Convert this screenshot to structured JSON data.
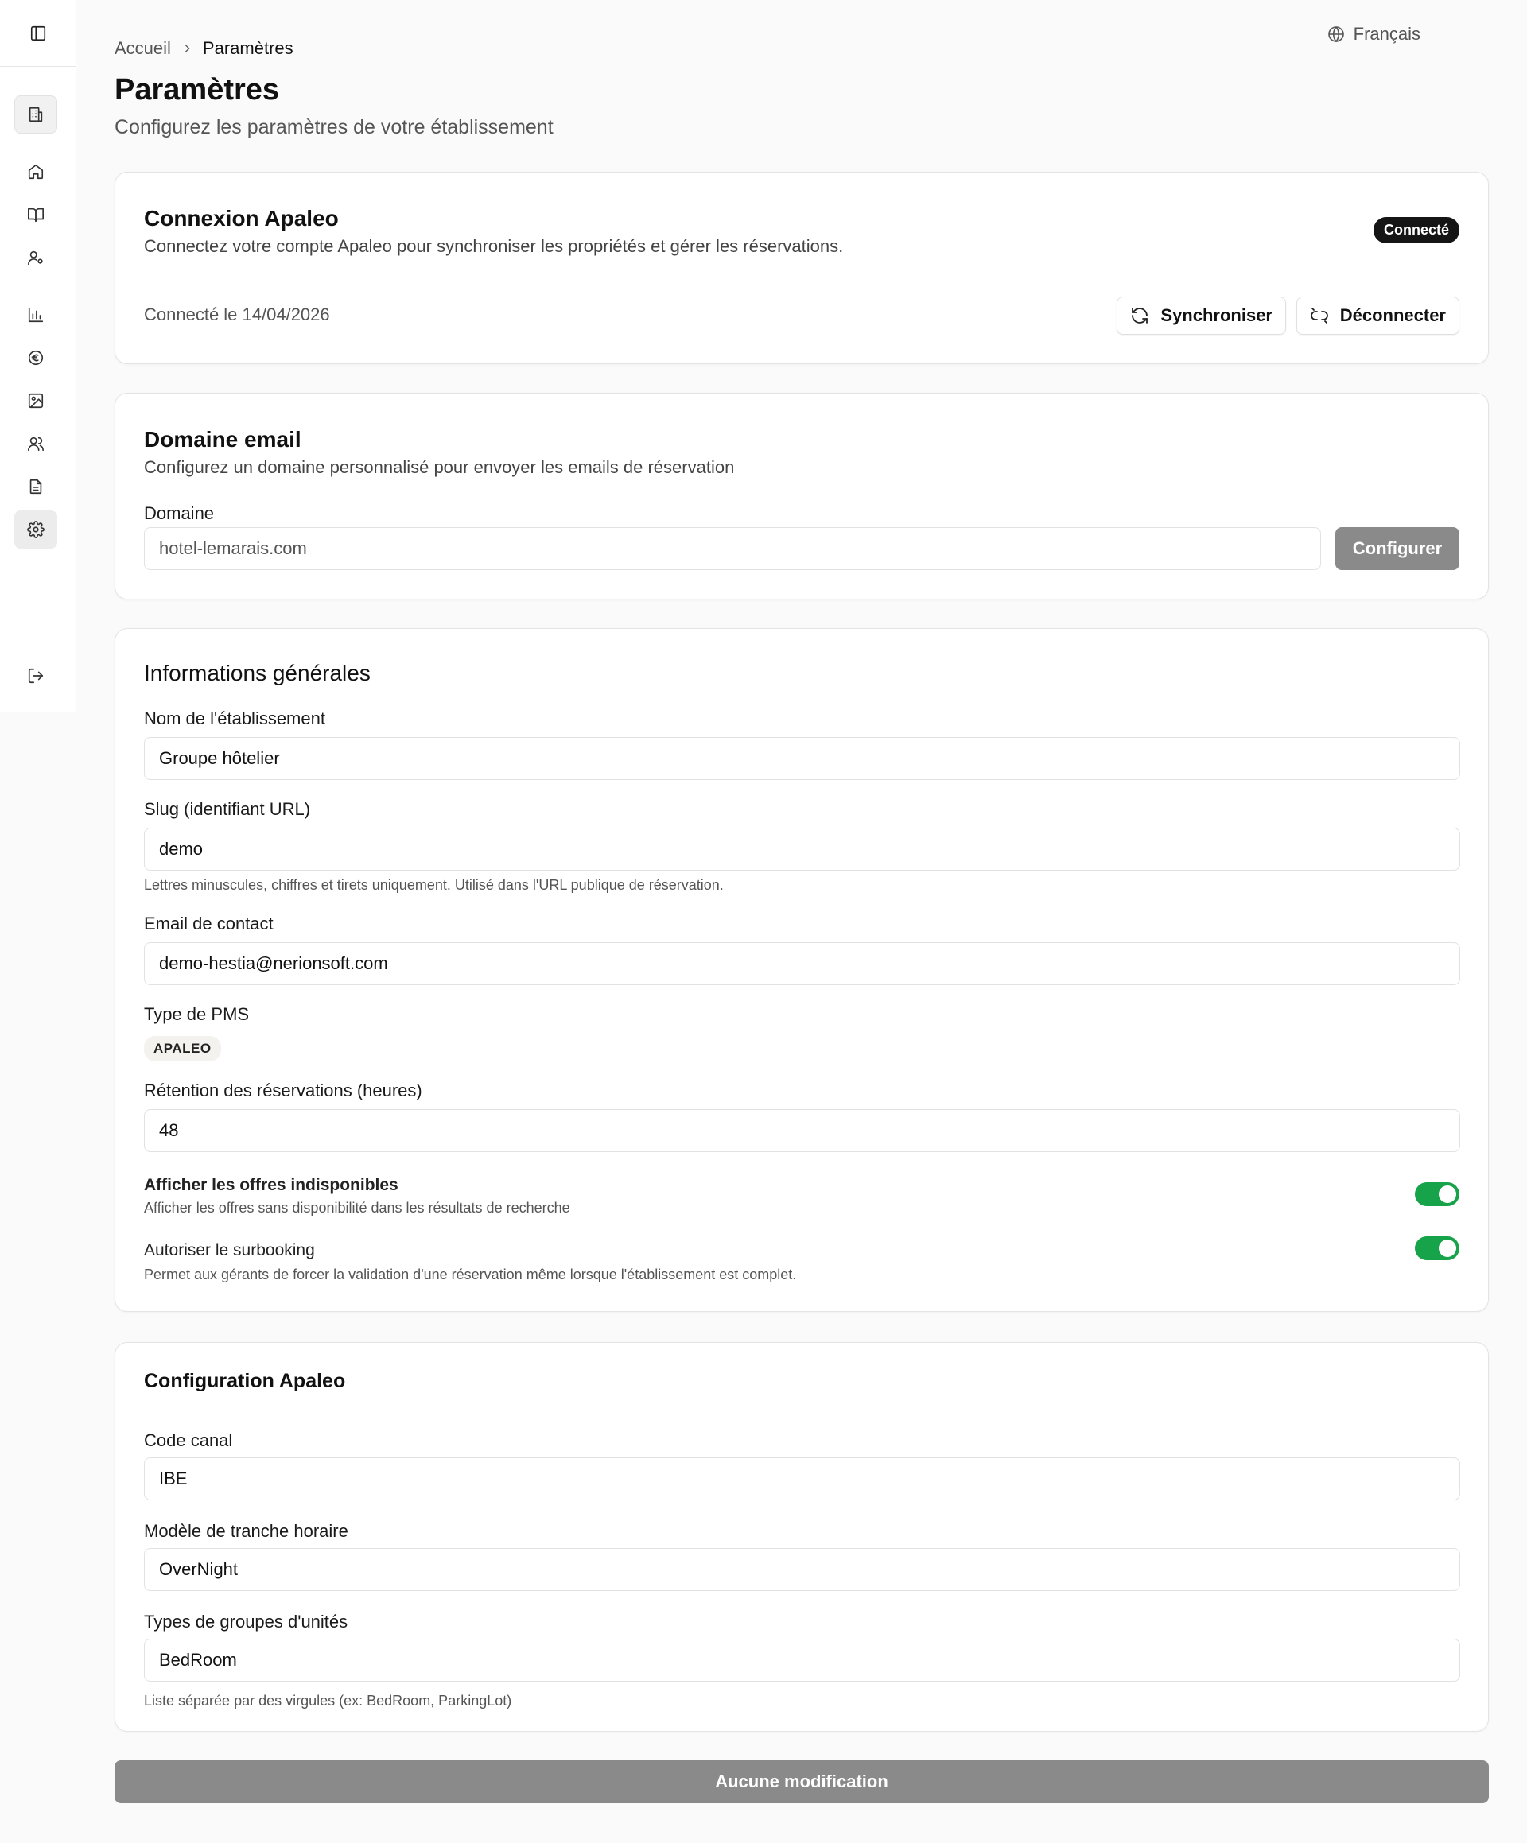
{
  "sidebar": {
    "toggle_icon": "sidebar-toggle-icon",
    "items": [
      {
        "icon": "building-icon"
      },
      {
        "icon": "home-icon"
      },
      {
        "icon": "book-open-icon"
      },
      {
        "icon": "user-cog-icon"
      },
      {
        "icon": "bar-chart-icon"
      },
      {
        "icon": "euro-icon"
      },
      {
        "icon": "image-icon"
      },
      {
        "icon": "users-icon"
      },
      {
        "icon": "file-text-icon"
      },
      {
        "icon": "settings-icon"
      }
    ],
    "logout_icon": "logout-icon"
  },
  "header": {
    "language": "Français",
    "breadcrumb": {
      "home": "Accueil",
      "current": "Paramètres"
    },
    "title": "Paramètres",
    "subtitle": "Configurez les paramètres de votre établissement"
  },
  "apaleo_connection": {
    "title": "Connexion Apaleo",
    "description": "Connectez votre compte Apaleo pour synchroniser les propriétés et gérer les réservations.",
    "status_badge": "Connecté",
    "connected_on": "Connecté le 14/04/2026",
    "sync_label": "Synchroniser",
    "disconnect_label": "Déconnecter"
  },
  "email_domain": {
    "title": "Domaine email",
    "description": "Configurez un domaine personnalisé pour envoyer les emails de réservation",
    "domain_label": "Domaine",
    "domain_value": "hotel-lemarais.com",
    "configure_label": "Configurer"
  },
  "general": {
    "title": "Informations générales",
    "name_label": "Nom de l'établissement",
    "name_value": "Groupe hôtelier",
    "slug_label": "Slug (identifiant URL)",
    "slug_value": "demo",
    "slug_help": "Lettres minuscules, chiffres et tirets uniquement. Utilisé dans l'URL publique de réservation.",
    "email_label": "Email de contact",
    "email_value": "demo-hestia@nerionsoft.com",
    "pms_label": "Type de PMS",
    "pms_value": "APALEO",
    "retention_label": "Rétention des réservations (heures)",
    "retention_value": "48",
    "show_unavailable_title": "Afficher les offres indisponibles",
    "show_unavailable_desc": "Afficher les offres sans disponibilité dans les résultats de recherche",
    "show_unavailable_on": true,
    "overbooking_title": "Autoriser le surbooking",
    "overbooking_desc": "Permet aux gérants de forcer la validation d'une réservation même lorsque l'établissement est complet.",
    "overbooking_on": true
  },
  "apaleo_config": {
    "title": "Configuration Apaleo",
    "channel_label": "Code canal",
    "channel_value": "IBE",
    "timeslice_label": "Modèle de tranche horaire",
    "timeslice_value": "OverNight",
    "unit_groups_label": "Types de groupes d'unités",
    "unit_groups_value": "BedRoom",
    "unit_groups_help": "Liste séparée par des virgules (ex: BedRoom, ParkingLot)"
  },
  "save_label": "Aucune modification",
  "colors": {
    "toggle_on": "#16a34a",
    "badge_bg": "#151515",
    "disabled_button": "#8a8a8a"
  }
}
